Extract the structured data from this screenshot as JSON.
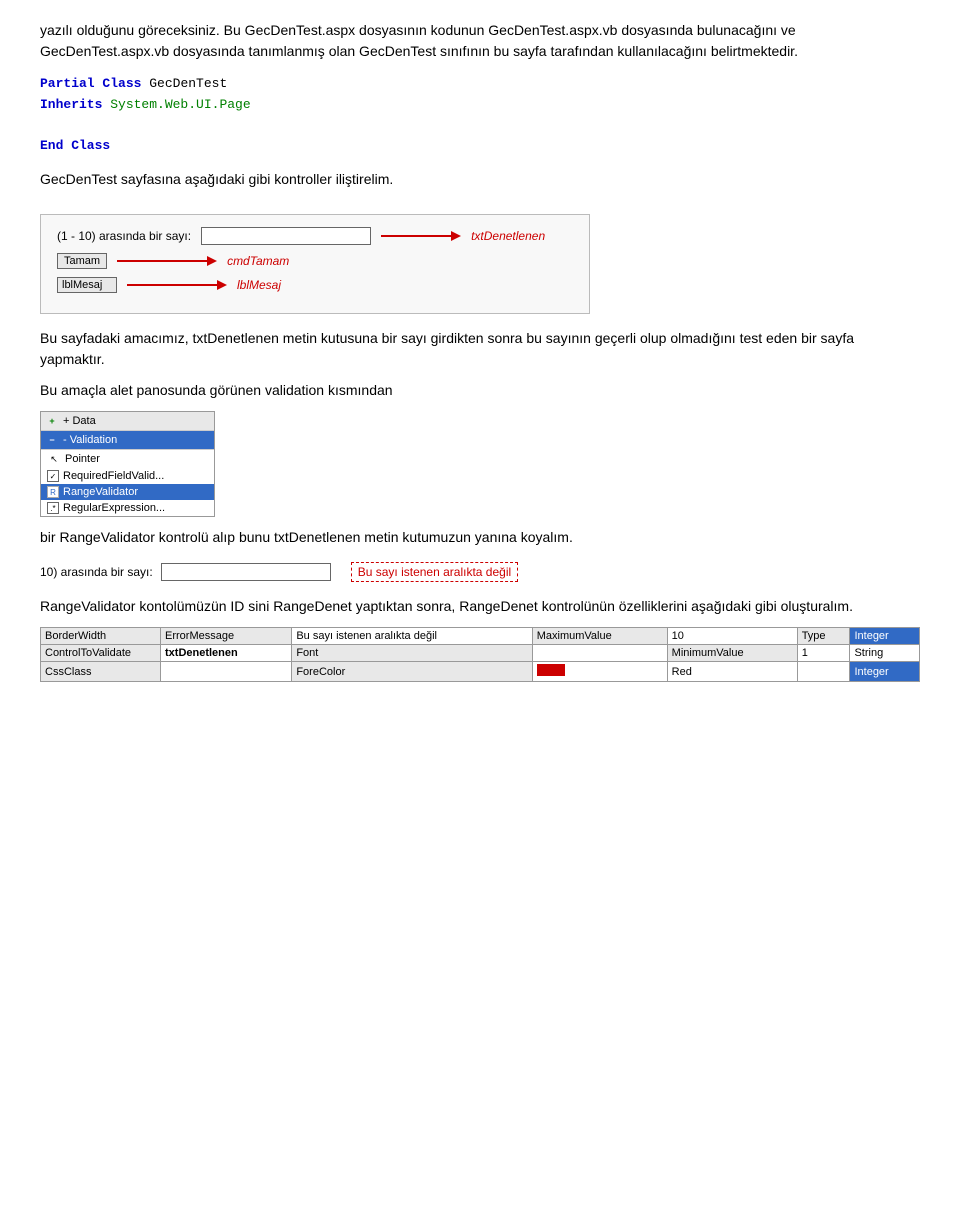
{
  "paragraphs": {
    "p1": "yazılı olduğunu göreceksiniz. Bu GecDenTest.aspx dosyasının kodunun GecDenTest.aspx.vb dosyasında bulunacağını ve GecDenTest.aspx.vb dosyasında tanımlanmış olan GecDenTest sınıfının bu sayfa tarafından kullanılacağını belirtmektedir.",
    "p2": "GecDenTest sayfasına aşağıdaki gibi kontroller iliştirelim.",
    "p3": "Bu sayfadaki amacımız, txtDenetlenen metin kutusuna bir sayı girdikten sonra bu sayının geçerli olup olmadığını test eden bir sayfa yapmaktır.",
    "p4": " Bu amaçla alet panosunda görünen validation kısmından",
    "p5": "bir RangeValidator kontrolü alıp bunu txtDenetlenen metin kutumuzun yanına koyalım.",
    "p6": "RangeValidator kontolümüzün ID sini  RangeDenet yaptıktan sonra, RangeDenet kontrolünün özelliklerini aşağıdaki gibi oluşturalım."
  },
  "code": {
    "line1_kw1": "Partial",
    "line1_kw2": "Class",
    "line1_class": " GecDenTest",
    "line2_kw": "    Inherits",
    "line2_val": " System.Web.UI.Page",
    "line3": "",
    "line4_kw1": "End",
    "line4_kw2": " Class"
  },
  "demo1": {
    "label": "(1 - 10) arasında bir sayı:",
    "ctrl_name1": "txtDenetlenen",
    "btn_label": "Tamam",
    "ctrl_name2": "cmdTamam",
    "lbl_ctrl": "lblMesaj",
    "ctrl_name3": "lblMesaj"
  },
  "demo2": {
    "label": "10) arasında bir sayı:",
    "error_text": "Bu sayı istenen aralıkta değil"
  },
  "toolbox": {
    "group_data": "+ Data",
    "group_validation": "- Validation",
    "items": [
      "Pointer",
      "RequiredFieldValid...",
      "RangeValidator",
      "RegularExpression..."
    ]
  },
  "bottom_props": {
    "col1_row1_label": "BorderWidth",
    "col1_row2_label": "ControlToValidate",
    "col1_row2_val": "txtDenetlenen",
    "col1_row3_label": "CssClass",
    "col2_row1_label": "ErrorMessage",
    "col2_row1_val": "Bu sayı istenen aralıkta değil",
    "col2_row2_label": "Font",
    "col2_row3_label": "ForeColor",
    "col2_row3_val": "Red",
    "col3_row1_label": "MaximumValue",
    "col3_row1_val": "10",
    "col3_row2_label": "MinimumValue",
    "col3_row2_val": "1",
    "col4_row1_label": "Type",
    "col4_row1_val": "Integer",
    "col4_row2_val": "String",
    "col4_row3_val": "Integer"
  }
}
